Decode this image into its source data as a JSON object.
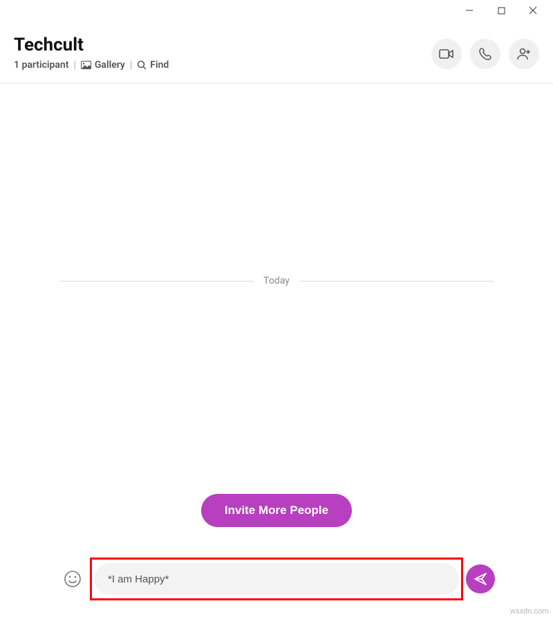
{
  "header": {
    "title": "Techcult",
    "participants": "1 participant",
    "gallery_label": "Gallery",
    "find_label": "Find"
  },
  "chat": {
    "date_label": "Today",
    "invite_button": "Invite More People"
  },
  "composer": {
    "message_value": "*I am Happy*"
  },
  "watermark": "wsxdn.com"
}
